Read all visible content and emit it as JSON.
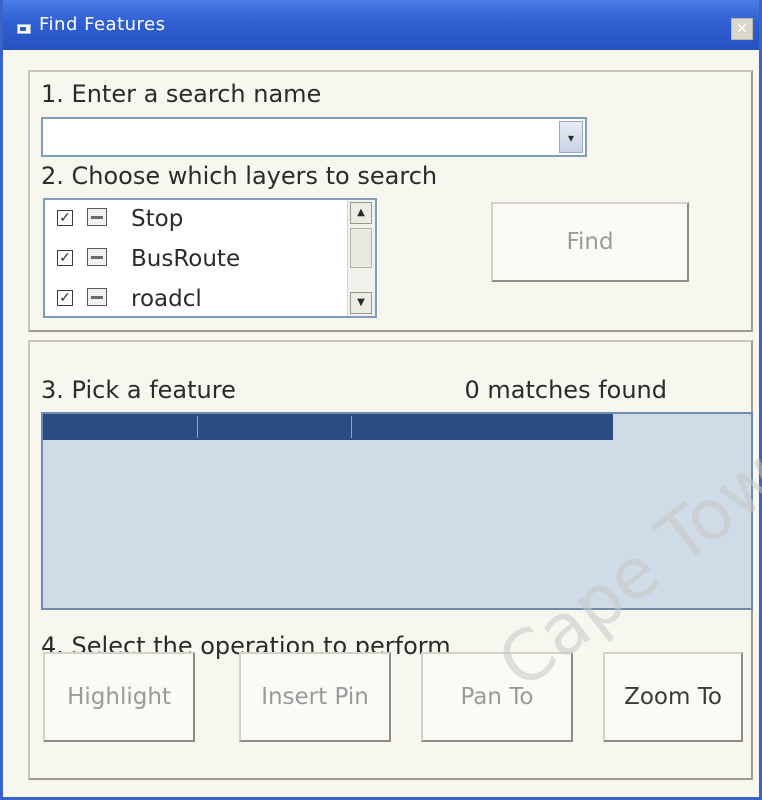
{
  "window": {
    "title": "Find Features",
    "close_glyph": "✕"
  },
  "section1": {
    "label": "1. Enter a search name",
    "search_value": "",
    "dropdown_glyph": "▾"
  },
  "section2": {
    "label": "2. Choose which layers to search",
    "layers": [
      {
        "name": "Stop",
        "checked": true,
        "icon": "feature-layer-icon"
      },
      {
        "name": "BusRoute",
        "checked": true,
        "icon": "feature-layer-icon"
      },
      {
        "name": "roadcl",
        "checked": true,
        "icon": "feature-layer-icon"
      }
    ],
    "check_glyph": "✓",
    "scroll_up_glyph": "▲",
    "scroll_down_glyph": "▼",
    "find_label": "Find"
  },
  "section3": {
    "label": "3. Pick a feature",
    "matches_text": "0 matches found",
    "header_color": "#2a4b84",
    "list_bg_color": "#cfdbe6"
  },
  "section4": {
    "label": "4. Select the operation to perform",
    "buttons": {
      "highlight": "Highlight",
      "insert_pin": "Insert Pin",
      "pan_to": "Pan To",
      "zoom_to": "Zoom To"
    }
  },
  "watermark": "Cape Town",
  "colors": {
    "titlebar": "#2f5fd1",
    "panel_bg": "#f7f6ef"
  }
}
